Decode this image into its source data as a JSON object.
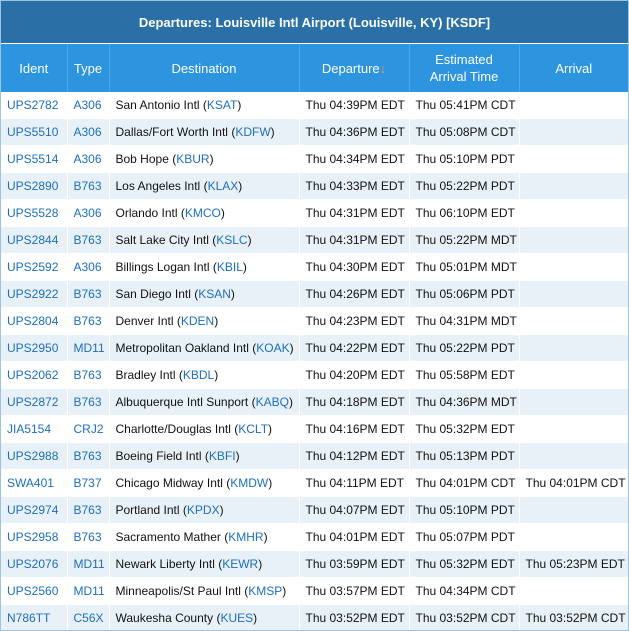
{
  "title": "Departures: Louisville Intl Airport (Louisville, KY) [KSDF]",
  "colors": {
    "title_bg": "#2a6fa6",
    "header_bg": "#2d95e0",
    "link": "#1c6fbf",
    "sort_arrow": "#f7941e",
    "row_alt": "#e9f1f8"
  },
  "columns": {
    "ident": "Ident",
    "type": "Type",
    "destination": "Destination",
    "departure": "Departure",
    "sort_icon": "↓",
    "eta_line1": "Estimated",
    "eta_line2": "Arrival Time",
    "arrival": "Arrival"
  },
  "flights": [
    {
      "ident": "UPS2782",
      "type": "A306",
      "dest_name": "San Antonio Intl",
      "dest_code": "KSAT",
      "departure": "Thu 04:39PM EDT",
      "eta": "Thu 05:41PM CDT",
      "arrival": ""
    },
    {
      "ident": "UPS5510",
      "type": "A306",
      "dest_name": "Dallas/Fort Worth Intl",
      "dest_code": "KDFW",
      "departure": "Thu 04:36PM EDT",
      "eta": "Thu 05:08PM CDT",
      "arrival": ""
    },
    {
      "ident": "UPS5514",
      "type": "A306",
      "dest_name": "Bob Hope",
      "dest_code": "KBUR",
      "departure": "Thu 04:34PM EDT",
      "eta": "Thu 05:10PM PDT",
      "arrival": ""
    },
    {
      "ident": "UPS2890",
      "type": "B763",
      "dest_name": "Los Angeles Intl",
      "dest_code": "KLAX",
      "departure": "Thu 04:33PM EDT",
      "eta": "Thu 05:22PM PDT",
      "arrival": ""
    },
    {
      "ident": "UPS5528",
      "type": "A306",
      "dest_name": "Orlando Intl",
      "dest_code": "KMCO",
      "departure": "Thu 04:31PM EDT",
      "eta": "Thu 06:10PM EDT",
      "arrival": ""
    },
    {
      "ident": "UPS2844",
      "type": "B763",
      "dest_name": "Salt Lake City Intl",
      "dest_code": "KSLC",
      "departure": "Thu 04:31PM EDT",
      "eta": "Thu 05:22PM MDT",
      "arrival": ""
    },
    {
      "ident": "UPS2592",
      "type": "A306",
      "dest_name": "Billings Logan Intl",
      "dest_code": "KBIL",
      "departure": "Thu 04:30PM EDT",
      "eta": "Thu 05:01PM MDT",
      "arrival": ""
    },
    {
      "ident": "UPS2922",
      "type": "B763",
      "dest_name": "San Diego Intl",
      "dest_code": "KSAN",
      "departure": "Thu 04:26PM EDT",
      "eta": "Thu 05:06PM PDT",
      "arrival": ""
    },
    {
      "ident": "UPS2804",
      "type": "B763",
      "dest_name": "Denver Intl",
      "dest_code": "KDEN",
      "departure": "Thu 04:23PM EDT",
      "eta": "Thu 04:31PM MDT",
      "arrival": ""
    },
    {
      "ident": "UPS2950",
      "type": "MD11",
      "dest_name": "Metropolitan Oakland Intl",
      "dest_code": "KOAK",
      "departure": "Thu 04:22PM EDT",
      "eta": "Thu 05:22PM PDT",
      "arrival": ""
    },
    {
      "ident": "UPS2062",
      "type": "B763",
      "dest_name": "Bradley Intl",
      "dest_code": "KBDL",
      "departure": "Thu 04:20PM EDT",
      "eta": "Thu 05:58PM EDT",
      "arrival": ""
    },
    {
      "ident": "UPS2872",
      "type": "B763",
      "dest_name": "Albuquerque Intl Sunport",
      "dest_code": "KABQ",
      "departure": "Thu 04:18PM EDT",
      "eta": "Thu 04:36PM MDT",
      "arrival": ""
    },
    {
      "ident": "JIA5154",
      "type": "CRJ2",
      "dest_name": "Charlotte/Douglas Intl",
      "dest_code": "KCLT",
      "departure": "Thu 04:16PM EDT",
      "eta": "Thu 05:32PM EDT",
      "arrival": ""
    },
    {
      "ident": "UPS2988",
      "type": "B763",
      "dest_name": "Boeing Field Intl",
      "dest_code": "KBFI",
      "departure": "Thu 04:12PM EDT",
      "eta": "Thu 05:13PM PDT",
      "arrival": ""
    },
    {
      "ident": "SWA401",
      "type": "B737",
      "dest_name": "Chicago Midway Intl",
      "dest_code": "KMDW",
      "departure": "Thu 04:11PM EDT",
      "eta": "Thu 04:01PM CDT",
      "arrival": "Thu 04:01PM CDT"
    },
    {
      "ident": "UPS2974",
      "type": "B763",
      "dest_name": "Portland Intl",
      "dest_code": "KPDX",
      "departure": "Thu 04:07PM EDT",
      "eta": "Thu 05:10PM PDT",
      "arrival": ""
    },
    {
      "ident": "UPS2958",
      "type": "B763",
      "dest_name": "Sacramento Mather",
      "dest_code": "KMHR",
      "departure": "Thu 04:01PM EDT",
      "eta": "Thu 05:07PM PDT",
      "arrival": ""
    },
    {
      "ident": "UPS2076",
      "type": "MD11",
      "dest_name": "Newark Liberty Intl",
      "dest_code": "KEWR",
      "departure": "Thu 03:59PM EDT",
      "eta": "Thu 05:32PM EDT",
      "arrival": "Thu 05:23PM EDT"
    },
    {
      "ident": "UPS2560",
      "type": "MD11",
      "dest_name": "Minneapolis/St Paul Intl",
      "dest_code": "KMSP",
      "departure": "Thu 03:57PM EDT",
      "eta": "Thu 04:34PM CDT",
      "arrival": ""
    },
    {
      "ident": "N786TT",
      "type": "C56X",
      "dest_name": "Waukesha County",
      "dest_code": "KUES",
      "departure": "Thu 03:52PM EDT",
      "eta": "Thu 03:52PM CDT",
      "arrival": "Thu 03:52PM CDT"
    }
  ]
}
